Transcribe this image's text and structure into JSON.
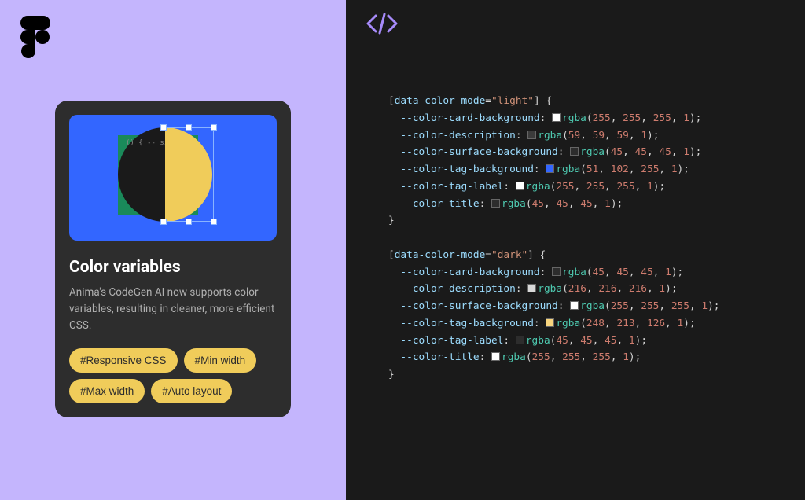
{
  "card": {
    "title": "Color variables",
    "description": "Anima's CodeGen AI now supports color variables, resulting in cleaner, more efficient CSS.",
    "tags": [
      "#Responsive CSS",
      "#Min width",
      "#Max width",
      "#Auto layout"
    ],
    "heroCodeSnippet": " () {\n  --\n  ss'\n});\n () {"
  },
  "codeSelectors": {
    "light": "[data-color-mode=\"light\"]",
    "dark": "[data-color-mode=\"dark\"]"
  },
  "cssVars": {
    "light": [
      {
        "name": "--color-card-background",
        "swatch": "#ffffff",
        "rgba": [
          255,
          255,
          255,
          1
        ]
      },
      {
        "name": "--color-description",
        "swatch": "#3b3b3b",
        "rgba": [
          59,
          59,
          59,
          1
        ]
      },
      {
        "name": "--color-surface-background",
        "swatch": "#2d2d2d",
        "rgba": [
          45,
          45,
          45,
          1
        ]
      },
      {
        "name": "--color-tag-background",
        "swatch": "#3366ff",
        "rgba": [
          51,
          102,
          255,
          1
        ]
      },
      {
        "name": "--color-tag-label",
        "swatch": "#ffffff",
        "rgba": [
          255,
          255,
          255,
          1
        ]
      },
      {
        "name": "--color-title",
        "swatch": "#2d2d2d",
        "rgba": [
          45,
          45,
          45,
          1
        ]
      }
    ],
    "dark": [
      {
        "name": "--color-card-background",
        "swatch": "#2d2d2d",
        "rgba": [
          45,
          45,
          45,
          1
        ]
      },
      {
        "name": "--color-description",
        "swatch": "#d8d8d8",
        "rgba": [
          216,
          216,
          216,
          1
        ]
      },
      {
        "name": "--color-surface-background",
        "swatch": "#ffffff",
        "rgba": [
          255,
          255,
          255,
          1
        ]
      },
      {
        "name": "--color-tag-background",
        "swatch": "#f8d57e",
        "rgba": [
          248,
          213,
          126,
          1
        ]
      },
      {
        "name": "--color-tag-label",
        "swatch": "#2d2d2d",
        "rgba": [
          45,
          45,
          45,
          1
        ]
      },
      {
        "name": "--color-title",
        "swatch": "#ffffff",
        "rgba": [
          255,
          255,
          255,
          1
        ]
      }
    ]
  }
}
